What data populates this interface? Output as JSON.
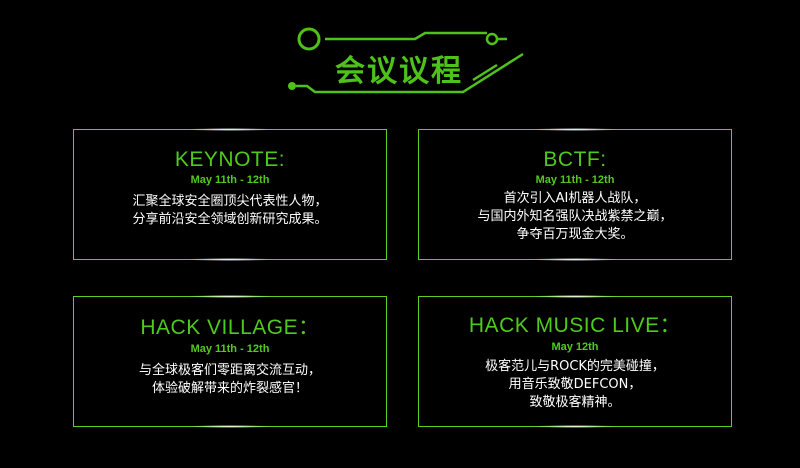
{
  "header": {
    "title": "会议议程",
    "accent_color": "#4fc21a"
  },
  "cards": [
    {
      "title": "KEYNOTE:",
      "date": "May 11th - 12th",
      "lines": [
        "汇聚全球安全圈顶尖代表性人物，",
        "分享前沿安全领域创新研究成果。"
      ]
    },
    {
      "title": "BCTF:",
      "date": "May 11th - 12th",
      "lines": [
        "首次引入AI机器人战队，",
        "与国内外知名强队决战紫禁之巅，",
        "争夺百万现金大奖。"
      ]
    },
    {
      "title": "HACK VILLAGE：",
      "date": "May 11th - 12th",
      "lines": [
        "与全球极客们零距离交流互动，",
        "体验破解带来的炸裂感官！"
      ]
    },
    {
      "title": "HACK MUSIC LIVE：",
      "date": "May 12th",
      "lines": [
        "极客范儿与ROCK的完美碰撞，",
        "用音乐致敬DEFCON，",
        "致敬极客精神。"
      ]
    }
  ]
}
